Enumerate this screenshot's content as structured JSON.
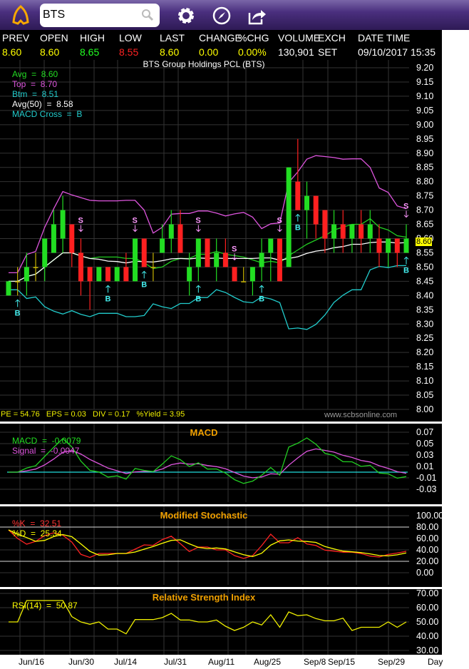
{
  "header": {
    "search_value": "BTS",
    "icons": [
      "app-logo-icon",
      "search-icon",
      "gear-icon",
      "compass-icon",
      "share-icon"
    ]
  },
  "quote": {
    "labels": [
      "PREV",
      "OPEN",
      "HIGH",
      "LOW",
      "LAST",
      "CHANGE",
      "%CHG",
      "VOLUME",
      "EXCH",
      "DATE TIME"
    ],
    "values": {
      "prev": "8.60",
      "open": "8.60",
      "high": "8.65",
      "low": "8.55",
      "last": "8.60",
      "change": "0.00",
      "pchg": "0.00%",
      "volume": "130,901",
      "exch": "SET",
      "datetime": "09/10/2017 15:35"
    }
  },
  "main": {
    "title": "BTS Group Holdings PCL (BTS)",
    "legend": [
      "Avg  =  8.60",
      "Top  =  8.70",
      "Btm  =  8.51",
      "Avg(50)  =  8.58",
      "MACD Cross  =  B"
    ],
    "footer": "PE = 54.76   EPS = 0.03   DIV = 0.17   %Yield = 3.95",
    "watermark": "www.scbsonline.com",
    "last_tag": "8.60"
  },
  "macd": {
    "title": "MACD",
    "legend": [
      "MACD  =  -0.0079",
      "Signal  =  -0.0047"
    ]
  },
  "stoch": {
    "title": "Modified Stochastic",
    "legend": [
      "%K  =  32.51",
      "%D  =  25.34"
    ]
  },
  "rsi": {
    "title": "Relative Strength Index",
    "legend": [
      "RSI(14)  =  50.87"
    ]
  },
  "dates": [
    "Jun/16",
    "Jun/30",
    "Jul/14",
    "Jul/31",
    "Aug/11",
    "Aug/25",
    "Sep/8",
    "Sep/15",
    "Sep/29",
    "Day"
  ],
  "colors": {
    "up": "#22dd22",
    "down": "#ff2020",
    "flat": "#c8b400",
    "avg": "#22cc22",
    "top": "#dd55dd",
    "btm": "#22cccc",
    "avg50": "#ffffff"
  },
  "chart_data": [
    {
      "type": "candlestick",
      "title": "BTS Group Holdings PCL (BTS)",
      "ylim": [
        8.0,
        9.2
      ],
      "yticks": [
        9.2,
        9.15,
        9.1,
        9.05,
        9.0,
        8.95,
        8.9,
        8.85,
        8.8,
        8.75,
        8.7,
        8.65,
        8.6,
        8.55,
        8.5,
        8.45,
        8.4,
        8.35,
        8.3,
        8.25,
        8.2,
        8.15,
        8.1,
        8.05,
        8.0
      ],
      "ohlc": [
        [
          8.4,
          8.45,
          8.4,
          8.45
        ],
        [
          8.45,
          8.5,
          8.4,
          8.45
        ],
        [
          8.45,
          8.55,
          8.4,
          8.5
        ],
        [
          8.5,
          8.55,
          8.45,
          8.5
        ],
        [
          8.5,
          8.6,
          8.45,
          8.6
        ],
        [
          8.55,
          8.7,
          8.55,
          8.65
        ],
        [
          8.6,
          8.75,
          8.55,
          8.7
        ],
        [
          8.65,
          8.65,
          8.5,
          8.55
        ],
        [
          8.55,
          8.6,
          8.4,
          8.45
        ],
        [
          8.5,
          8.5,
          8.35,
          8.45
        ],
        [
          8.45,
          8.5,
          8.45,
          8.5
        ],
        [
          8.5,
          8.5,
          8.45,
          8.45
        ],
        [
          8.45,
          8.5,
          8.45,
          8.5
        ],
        [
          8.5,
          8.55,
          8.45,
          8.45
        ],
        [
          8.45,
          8.6,
          8.45,
          8.6
        ],
        [
          8.6,
          8.6,
          8.5,
          8.5
        ],
        [
          8.5,
          8.55,
          8.45,
          8.5
        ],
        [
          8.55,
          8.65,
          8.55,
          8.6
        ],
        [
          8.6,
          8.7,
          8.55,
          8.65
        ],
        [
          8.65,
          8.7,
          8.55,
          8.55
        ],
        [
          8.45,
          8.55,
          8.4,
          8.5
        ],
        [
          8.5,
          8.6,
          8.45,
          8.6
        ],
        [
          8.6,
          8.6,
          8.5,
          8.5
        ],
        [
          8.5,
          8.6,
          8.45,
          8.55
        ],
        [
          8.55,
          8.6,
          8.5,
          8.5
        ],
        [
          8.5,
          8.5,
          8.45,
          8.45
        ],
        [
          8.45,
          8.5,
          8.45,
          8.45
        ],
        [
          8.45,
          8.5,
          8.4,
          8.5
        ],
        [
          8.5,
          8.6,
          8.45,
          8.55
        ],
        [
          8.55,
          8.6,
          8.45,
          8.6
        ],
        [
          8.6,
          8.6,
          8.45,
          8.45
        ],
        [
          8.5,
          8.85,
          8.5,
          8.85
        ],
        [
          8.8,
          8.95,
          8.7,
          8.7
        ],
        [
          8.7,
          8.8,
          8.6,
          8.75
        ],
        [
          8.75,
          8.75,
          8.6,
          8.65
        ],
        [
          8.7,
          8.7,
          8.55,
          8.6
        ],
        [
          8.6,
          8.7,
          8.55,
          8.65
        ],
        [
          8.65,
          8.7,
          8.55,
          8.6
        ],
        [
          8.6,
          8.65,
          8.55,
          8.65
        ],
        [
          8.65,
          8.7,
          8.55,
          8.6
        ],
        [
          8.6,
          8.7,
          8.55,
          8.65
        ],
        [
          8.6,
          8.65,
          8.5,
          8.55
        ],
        [
          8.55,
          8.6,
          8.5,
          8.6
        ],
        [
          8.6,
          8.6,
          8.5,
          8.55
        ],
        [
          8.55,
          8.65,
          8.55,
          8.6
        ]
      ],
      "signals": [
        [
          1,
          "B"
        ],
        [
          8,
          "S"
        ],
        [
          11,
          "B"
        ],
        [
          14,
          "S"
        ],
        [
          15,
          "B"
        ],
        [
          21,
          "S"
        ],
        [
          21,
          "B"
        ],
        [
          25,
          "S"
        ],
        [
          28,
          "B"
        ],
        [
          30,
          "S"
        ],
        [
          32,
          "B"
        ],
        [
          44,
          "S"
        ],
        [
          44,
          "B"
        ]
      ]
    },
    {
      "type": "line",
      "title": "MACD",
      "ylim": [
        -0.03,
        0.07
      ],
      "yticks": [
        "0.07",
        "0.05",
        "0.03",
        "0.01",
        "-0.01",
        "-0.03"
      ]
    },
    {
      "type": "line",
      "title": "Modified Stochastic",
      "ylim": [
        0,
        100
      ],
      "yticks": [
        "100.00",
        "80.00",
        "60.00",
        "40.00",
        "20.00",
        "0.00"
      ]
    },
    {
      "type": "line",
      "title": "Relative Strength Index",
      "ylim": [
        30,
        70
      ],
      "yticks": [
        "70.00",
        "60.00",
        "50.00",
        "40.00",
        "30.00"
      ]
    }
  ]
}
